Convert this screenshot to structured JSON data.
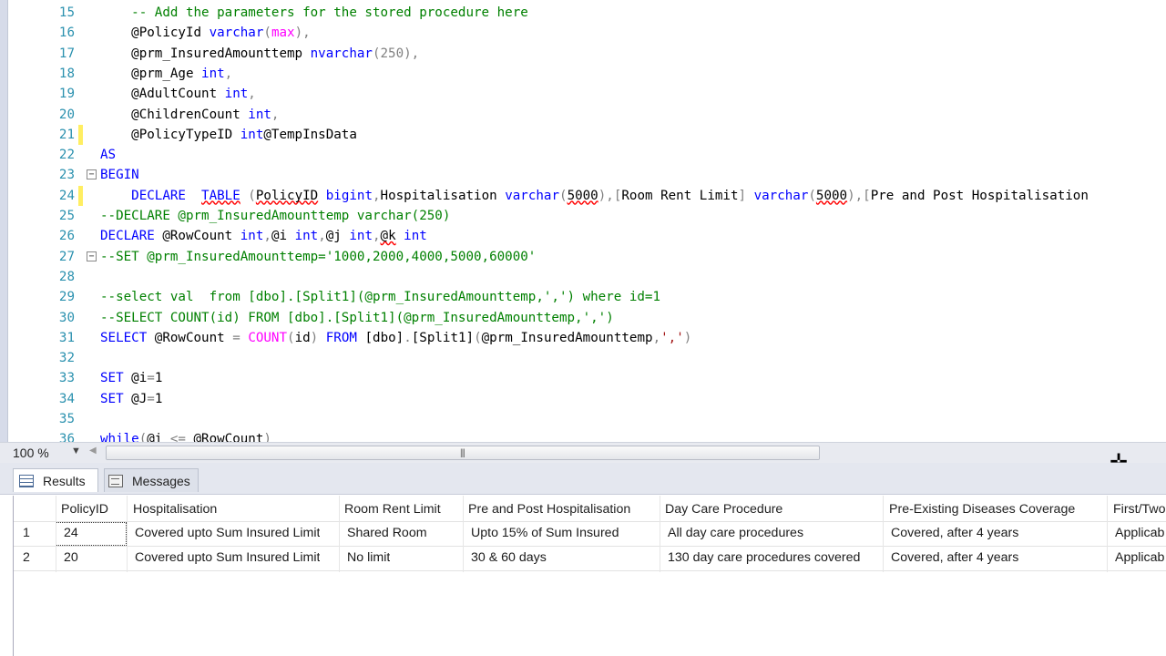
{
  "editor": {
    "lines": [
      {
        "n": "15",
        "mark": "",
        "fold": "",
        "tokens": [
          [
            "    -- Add the parameters for the stored procedure here",
            "cm"
          ]
        ]
      },
      {
        "n": "16",
        "mark": "",
        "fold": "",
        "tokens": [
          [
            "    @PolicyId ",
            "var"
          ],
          [
            "varchar",
            "kw"
          ],
          [
            "(",
            "op"
          ],
          [
            "max",
            "fn"
          ],
          [
            "),",
            "op"
          ]
        ]
      },
      {
        "n": "17",
        "mark": "",
        "fold": "",
        "tokens": [
          [
            "    @prm_InsuredAmounttemp ",
            "var"
          ],
          [
            "nvarchar",
            "kw"
          ],
          [
            "(250),",
            "op"
          ]
        ]
      },
      {
        "n": "18",
        "mark": "",
        "fold": "",
        "tokens": [
          [
            "    @prm_Age ",
            "var"
          ],
          [
            "int",
            "kw"
          ],
          [
            ",",
            "op"
          ]
        ]
      },
      {
        "n": "19",
        "mark": "",
        "fold": "",
        "tokens": [
          [
            "    @AdultCount ",
            "var"
          ],
          [
            "int",
            "kw"
          ],
          [
            ",",
            "op"
          ]
        ]
      },
      {
        "n": "20",
        "mark": "",
        "fold": "",
        "tokens": [
          [
            "    @ChildrenCount ",
            "var"
          ],
          [
            "int",
            "kw"
          ],
          [
            ",",
            "op"
          ]
        ]
      },
      {
        "n": "21",
        "mark": "yellow",
        "fold": "",
        "tokens": [
          [
            "    @PolicyTypeID ",
            "var"
          ],
          [
            "int",
            "kw"
          ],
          [
            "@TempInsData",
            "var"
          ]
        ]
      },
      {
        "n": "22",
        "mark": "",
        "fold": "",
        "tokens": [
          [
            "AS",
            "kw"
          ]
        ]
      },
      {
        "n": "23",
        "mark": "",
        "fold": "−",
        "tokens": [
          [
            "BEGIN",
            "kw"
          ]
        ]
      },
      {
        "n": "24",
        "mark": "yellow",
        "fold": "",
        "tokens": [
          [
            "    DECLARE  ",
            "kw"
          ],
          [
            "TABLE",
            "kwsq"
          ],
          [
            " (",
            "op"
          ],
          [
            "PolicyID",
            "varsq"
          ],
          [
            " ",
            "var"
          ],
          [
            "bigint",
            "kw"
          ],
          [
            ",",
            "op"
          ],
          [
            "Hospitalisation ",
            "var"
          ],
          [
            "varchar",
            "kw"
          ],
          [
            "(",
            "op"
          ],
          [
            "5000",
            "varsq"
          ],
          [
            "),[",
            "op"
          ],
          [
            "Room Rent Limit",
            "var"
          ],
          [
            "] ",
            "op"
          ],
          [
            "varchar",
            "kw"
          ],
          [
            "(",
            "op"
          ],
          [
            "5000",
            "varsq"
          ],
          [
            "),[",
            "op"
          ],
          [
            "Pre and Post Hospitalisation",
            "var"
          ]
        ]
      },
      {
        "n": "25",
        "mark": "",
        "fold": "",
        "tokens": [
          [
            "--DECLARE @prm_InsuredAmounttemp varchar(250)",
            "cm"
          ]
        ]
      },
      {
        "n": "26",
        "mark": "",
        "fold": "",
        "tokens": [
          [
            "DECLARE ",
            "kw"
          ],
          [
            "@RowCount ",
            "var"
          ],
          [
            "int",
            "kw"
          ],
          [
            ",",
            "op"
          ],
          [
            "@i ",
            "var"
          ],
          [
            "int",
            "kw"
          ],
          [
            ",",
            "op"
          ],
          [
            "@j ",
            "var"
          ],
          [
            "int",
            "kw"
          ],
          [
            ",",
            "op"
          ],
          [
            "@k",
            "varsq"
          ],
          [
            " ",
            "var"
          ],
          [
            "int",
            "kw"
          ]
        ]
      },
      {
        "n": "27",
        "mark": "",
        "fold": "−",
        "tokens": [
          [
            "--SET @prm_InsuredAmounttemp='1000,2000,4000,5000,60000'",
            "cm"
          ]
        ]
      },
      {
        "n": "28",
        "mark": "",
        "fold": "",
        "tokens": []
      },
      {
        "n": "29",
        "mark": "",
        "fold": "",
        "tokens": [
          [
            "--select val  from [dbo].[Split1](@prm_InsuredAmounttemp,',') where id=1",
            "cm"
          ]
        ]
      },
      {
        "n": "30",
        "mark": "",
        "fold": "",
        "tokens": [
          [
            "--SELECT COUNT(id) FROM [dbo].[Split1](@prm_InsuredAmounttemp,',')",
            "cm"
          ]
        ]
      },
      {
        "n": "31",
        "mark": "",
        "fold": "",
        "tokens": [
          [
            "SELECT ",
            "kw"
          ],
          [
            "@RowCount ",
            "var"
          ],
          [
            "= ",
            "op"
          ],
          [
            "COUNT",
            "fn"
          ],
          [
            "(",
            "op"
          ],
          [
            "id",
            "var"
          ],
          [
            ") ",
            "op"
          ],
          [
            "FROM ",
            "kw"
          ],
          [
            "[dbo]",
            "var"
          ],
          [
            ".",
            "op"
          ],
          [
            "[Split1]",
            "var"
          ],
          [
            "(",
            "op"
          ],
          [
            "@prm_InsuredAmounttemp",
            "var"
          ],
          [
            ",",
            "op"
          ],
          [
            "','",
            "str"
          ],
          [
            ")",
            "op"
          ]
        ]
      },
      {
        "n": "32",
        "mark": "",
        "fold": "",
        "tokens": []
      },
      {
        "n": "33",
        "mark": "",
        "fold": "",
        "tokens": [
          [
            "SET ",
            "kw"
          ],
          [
            "@i",
            "var"
          ],
          [
            "=",
            "op"
          ],
          [
            "1",
            "var"
          ]
        ]
      },
      {
        "n": "34",
        "mark": "",
        "fold": "",
        "tokens": [
          [
            "SET ",
            "kw"
          ],
          [
            "@J",
            "var"
          ],
          [
            "=",
            "op"
          ],
          [
            "1",
            "var"
          ]
        ]
      },
      {
        "n": "35",
        "mark": "",
        "fold": "",
        "tokens": []
      },
      {
        "n": "36",
        "mark": "",
        "fold": "",
        "tokens": [
          [
            "while",
            "kw"
          ],
          [
            "(",
            "op"
          ],
          [
            "@i ",
            "var"
          ],
          [
            "<= ",
            "op"
          ],
          [
            "@RowCount",
            "var"
          ],
          [
            ")",
            "op"
          ]
        ]
      }
    ]
  },
  "status": {
    "zoom": "100 %"
  },
  "tabs": {
    "results": "Results",
    "messages": "Messages"
  },
  "results": {
    "columns": [
      "PolicyID",
      "Hospitalisation",
      "Room Rent Limit",
      "Pre and Post Hospitalisation",
      "Day Care Procedure",
      "Pre-Existing Diseases Coverage",
      "First/Two"
    ],
    "rows": [
      [
        "1",
        "24",
        "Covered upto Sum Insured Limit",
        "Shared Room",
        "Upto 15% of Sum Insured",
        "All day care procedures",
        "Covered, after 4 years",
        "Applicab"
      ],
      [
        "2",
        "20",
        "Covered upto Sum Insured Limit",
        "No limit",
        "30 & 60 days",
        "130 day care procedures covered",
        "Covered, after 4 years",
        "Applicab"
      ]
    ]
  }
}
